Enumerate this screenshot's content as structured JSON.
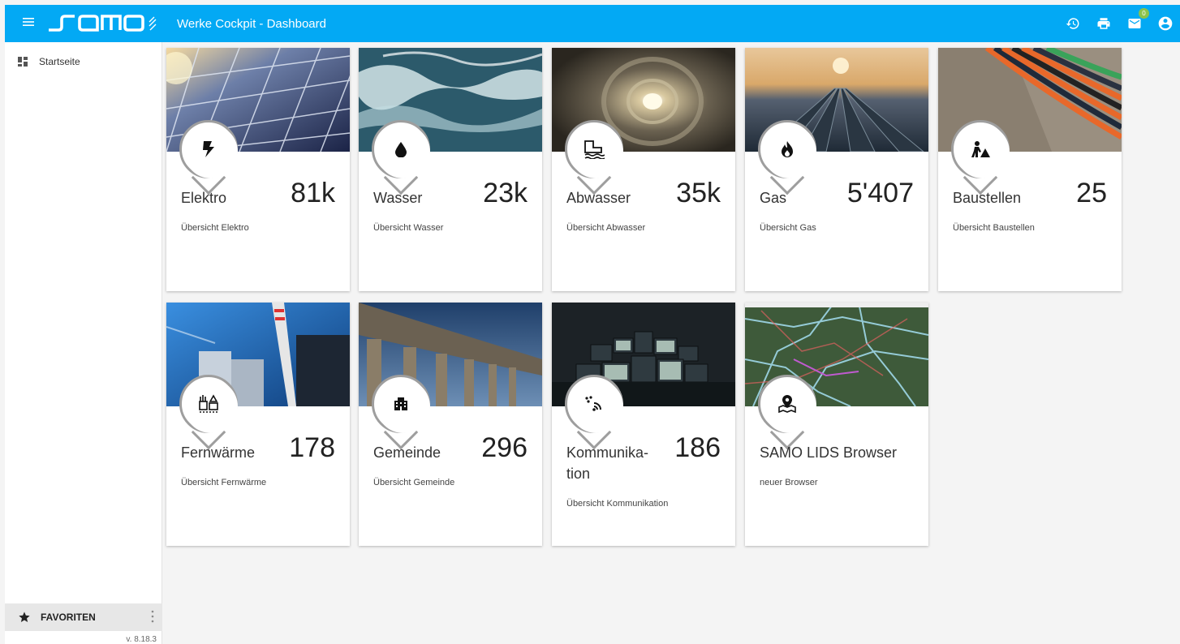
{
  "header": {
    "title": "Werke Cockpit - Dashboard",
    "brand": "samo",
    "mail_count": "0",
    "bar_color": "#03a9f4"
  },
  "sidebar": {
    "items": [
      {
        "label": "Startseite",
        "icon": "dashboard-icon"
      }
    ],
    "favorites_label": "FAVORITEN",
    "version": "v. 8.18.3"
  },
  "cards": [
    {
      "title": "Elektro",
      "count": "81k",
      "subtitle": "Übersicht Elektro",
      "icon": "bolt-icon",
      "image": "solar-panels"
    },
    {
      "title": "Wasser",
      "count": "23k",
      "subtitle": "Übersicht Wasser",
      "icon": "water-drop-icon",
      "image": "ocean-waves"
    },
    {
      "title": "Abwasser",
      "count": "35k",
      "subtitle": "Übersicht Abwasser",
      "icon": "sewage-icon",
      "image": "sewer-tunnel"
    },
    {
      "title": "Gas",
      "count": "5'407",
      "subtitle": "Übersicht Gas",
      "icon": "flame-icon",
      "image": "gas-pipelines"
    },
    {
      "title": "Baustellen",
      "count": "25",
      "subtitle": "Übersicht Baustellen",
      "icon": "construction-worker-icon",
      "image": "cable-pipes"
    },
    {
      "title": "Fernwärme",
      "count": "178",
      "subtitle": "Übersicht Fernwärme",
      "icon": "factory-icon",
      "image": "power-plant"
    },
    {
      "title": "Gemeinde",
      "count": "296",
      "subtitle": "Übersicht Gemeinde",
      "icon": "building-icon",
      "image": "columned-building"
    },
    {
      "title": "Kommunika-\ntion",
      "count": "186",
      "subtitle": "Übersicht Kommunikation",
      "icon": "signal-icon",
      "image": "tv-screens"
    },
    {
      "title": "SAMO LIDS Browser",
      "count": "",
      "subtitle": "neuer Browser",
      "icon": "map-marker-icon",
      "image": "gis-map"
    }
  ]
}
